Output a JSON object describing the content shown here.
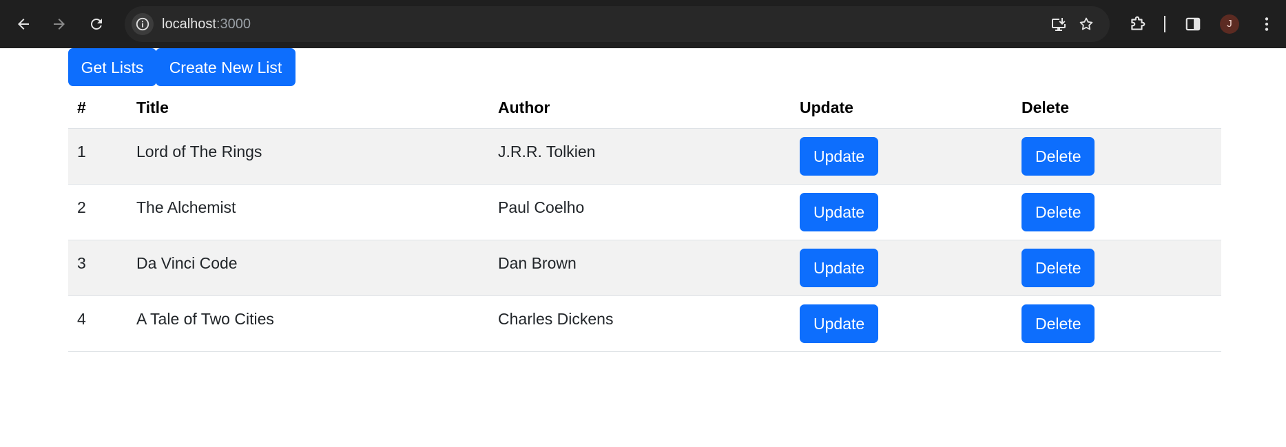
{
  "browser": {
    "url_host": "localhost",
    "url_port": ":3000",
    "profile_initial": "J",
    "icons": {
      "back": "back-arrow-icon",
      "forward": "forward-arrow-icon",
      "reload": "reload-icon",
      "site_info": "info-icon",
      "install": "install-app-icon",
      "bookmark": "star-icon",
      "extensions": "puzzle-icon",
      "side_panel": "side-panel-icon",
      "menu": "kebab-menu-icon"
    }
  },
  "toolbar": {
    "get_lists_label": "Get Lists",
    "create_label": "Create New List"
  },
  "table": {
    "headers": [
      "#",
      "Title",
      "Author",
      "Update",
      "Delete"
    ],
    "rows": [
      {
        "num": "1",
        "title": "Lord of The Rings",
        "author": "J.R.R. Tolkien",
        "update": "Update",
        "delete": "Delete"
      },
      {
        "num": "2",
        "title": "The Alchemist",
        "author": "Paul Coelho",
        "update": "Update",
        "delete": "Delete"
      },
      {
        "num": "3",
        "title": "Da Vinci Code",
        "author": "Dan Brown",
        "update": "Update",
        "delete": "Delete"
      },
      {
        "num": "4",
        "title": "A Tale of Two Cities",
        "author": "Charles Dickens",
        "update": "Update",
        "delete": "Delete"
      }
    ]
  },
  "colors": {
    "primary": "#0d6efd",
    "stripe": "#f2f2f2",
    "chrome_bg": "#1f1f1f"
  }
}
